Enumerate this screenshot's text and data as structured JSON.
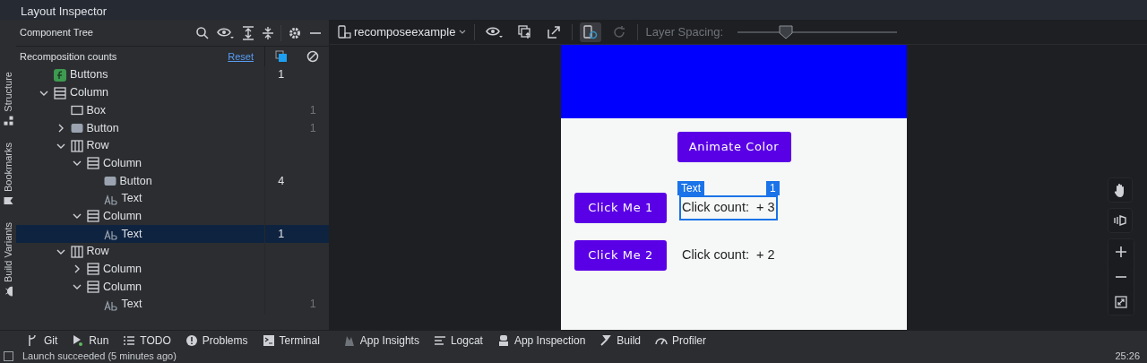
{
  "window": {
    "title": "Layout Inspector"
  },
  "side_tabs": [
    {
      "label": "Structure"
    },
    {
      "label": "Bookmarks"
    },
    {
      "label": "Build Variants"
    }
  ],
  "component_tree": {
    "title": "Component Tree",
    "recomposition_label": "Recomposition counts",
    "reset_link": "Reset",
    "nodes": [
      {
        "label": "Buttons",
        "kind": "compose",
        "recompositions": "1",
        "selected": false,
        "children": [
          {
            "label": "Column",
            "kind": "column",
            "expanded": true,
            "selected": false,
            "children": [
              {
                "label": "Box",
                "kind": "box",
                "skips": "1",
                "selected": false
              },
              {
                "label": "Button",
                "kind": "button",
                "expanded": false,
                "skips": "1",
                "selected": false
              },
              {
                "label": "Row",
                "kind": "row",
                "expanded": true,
                "selected": false,
                "children": [
                  {
                    "label": "Column",
                    "kind": "column",
                    "expanded": true,
                    "selected": false,
                    "children": [
                      {
                        "label": "Button",
                        "kind": "button",
                        "recompositions": "4",
                        "selected": false
                      },
                      {
                        "label": "Text",
                        "kind": "text",
                        "selected": false
                      }
                    ]
                  },
                  {
                    "label": "Column",
                    "kind": "column",
                    "expanded": true,
                    "selected": false,
                    "children": [
                      {
                        "label": "Text",
                        "kind": "text",
                        "recompositions": "1",
                        "selected": true
                      }
                    ]
                  }
                ]
              },
              {
                "label": "Row",
                "kind": "row",
                "expanded": true,
                "selected": false,
                "children": [
                  {
                    "label": "Column",
                    "kind": "column",
                    "expanded": false,
                    "selected": false
                  },
                  {
                    "label": "Column",
                    "kind": "column",
                    "expanded": true,
                    "selected": false,
                    "children": [
                      {
                        "label": "Text",
                        "kind": "text",
                        "skips": "1",
                        "selected": false
                      }
                    ]
                  }
                ]
              }
            ]
          }
        ]
      }
    ]
  },
  "toolbar": {
    "process": "recomposeexample",
    "live_updates_on": true,
    "layer_spacing_label": "Layer Spacing:",
    "layer_spacing": {
      "level": 0.3
    }
  },
  "device": {
    "animate_button": "Animate Color",
    "rows": [
      {
        "button": "Click Me 1",
        "text": "Click count:  + 3",
        "selected": true,
        "overlay_label": "Text",
        "overlay_count": "1"
      },
      {
        "button": "Click Me 2",
        "text": "Click count:  + 2",
        "selected": false
      }
    ]
  },
  "tool_windows": [
    {
      "label": "Git"
    },
    {
      "label": "Run"
    },
    {
      "label": "TODO"
    },
    {
      "label": "Problems"
    },
    {
      "label": "Terminal"
    },
    {
      "label": "App Insights"
    },
    {
      "label": "Logcat"
    },
    {
      "label": "App Inspection"
    },
    {
      "label": "Build"
    },
    {
      "label": "Profiler"
    }
  ],
  "status_bar": {
    "message": "Launch succeeded (5 minutes ago)",
    "time": "25:26"
  }
}
